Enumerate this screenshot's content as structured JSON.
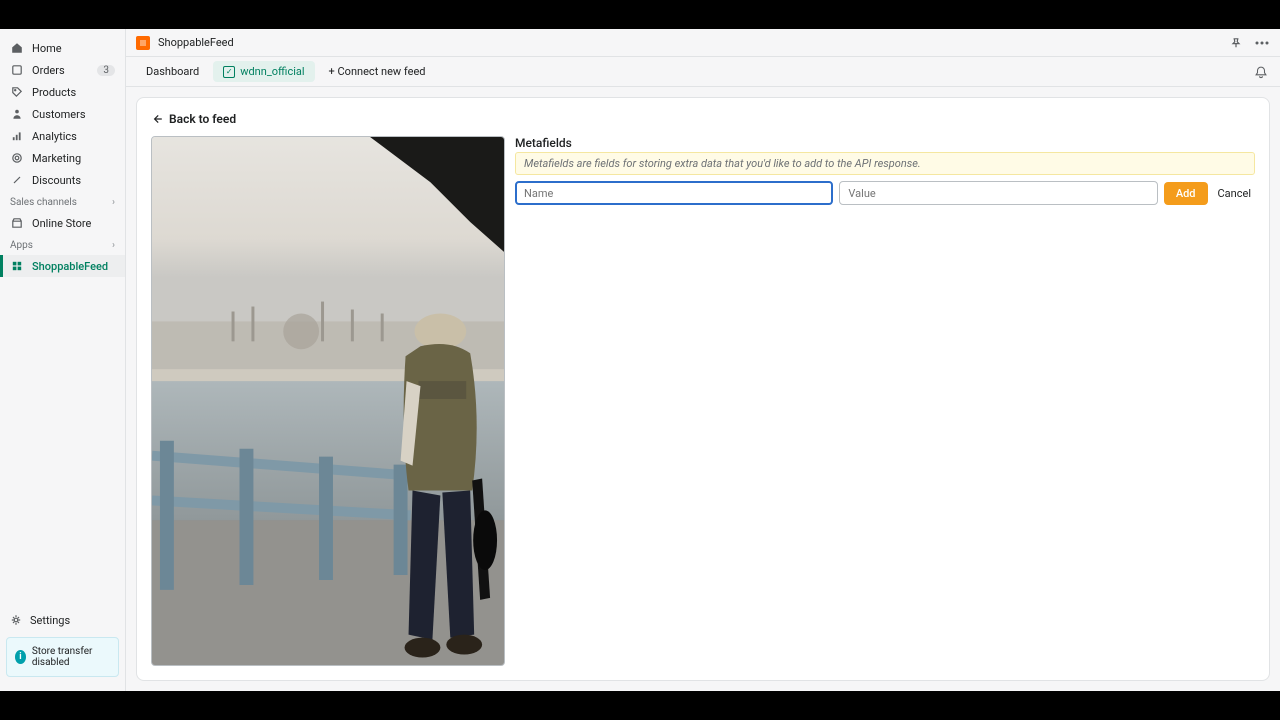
{
  "app": {
    "name": "ShoppableFeed"
  },
  "sidebar": {
    "items": [
      {
        "label": "Home"
      },
      {
        "label": "Orders",
        "badge": "3"
      },
      {
        "label": "Products"
      },
      {
        "label": "Customers"
      },
      {
        "label": "Analytics"
      },
      {
        "label": "Marketing"
      },
      {
        "label": "Discounts"
      }
    ],
    "sales_channels_label": "Sales channels",
    "online_store": "Online Store",
    "apps_label": "Apps",
    "active_app": "ShoppableFeed",
    "settings": "Settings",
    "transfer_banner": "Store transfer disabled"
  },
  "tabs": {
    "dashboard": "Dashboard",
    "active_feed": "wdnn_official",
    "connect": "+ Connect new feed"
  },
  "content": {
    "back_label": "Back to feed",
    "meta_title": "Metafields",
    "meta_desc": "Metafields are fields for storing extra data that you'd like to add to the API response.",
    "name_placeholder": "Name",
    "value_placeholder": "Value",
    "add_label": "Add",
    "cancel_label": "Cancel"
  }
}
